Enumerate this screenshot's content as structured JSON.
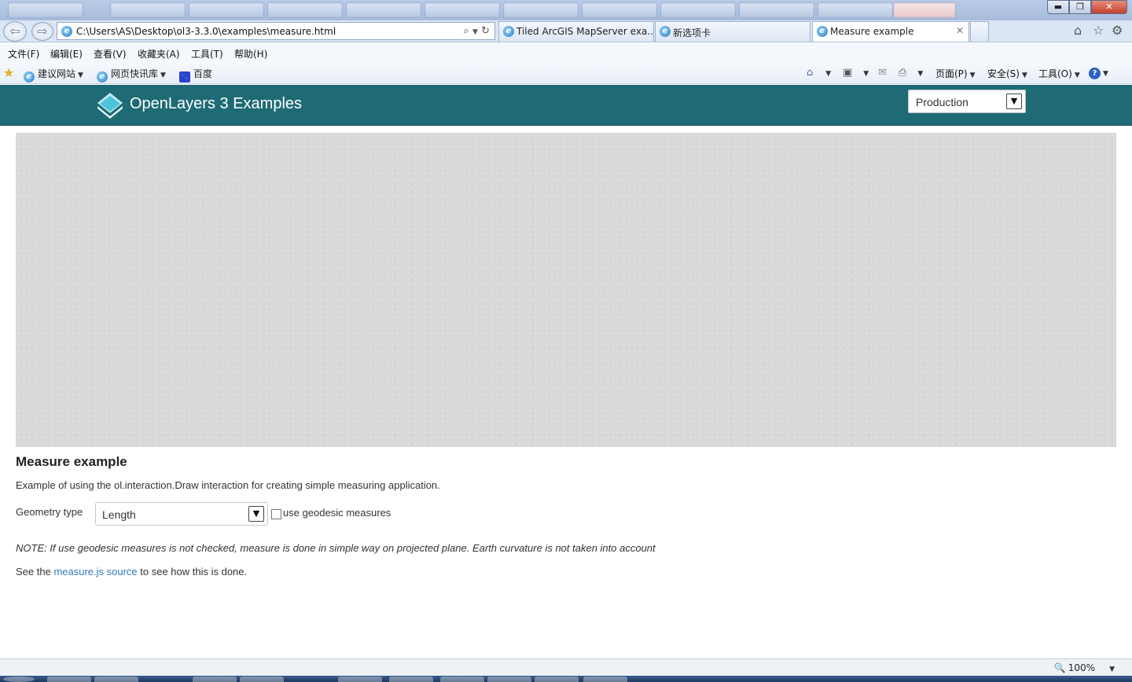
{
  "browser": {
    "address_url": "C:\\Users\\AS\\Desktop\\ol3-3.3.0\\examples\\measure.html",
    "tabs": [
      {
        "label": "Tiled ArcGIS MapServer exa...",
        "active": false
      },
      {
        "label": "新选项卡",
        "active": false
      },
      {
        "label": "Measure example",
        "active": true
      }
    ],
    "menu": [
      "文件(F)",
      "编辑(E)",
      "查看(V)",
      "收藏夹(A)",
      "工具(T)",
      "帮助(H)"
    ],
    "favorites": [
      "建议网站",
      "网页快讯库",
      "百度"
    ],
    "toolbar": {
      "page": "页面(P)",
      "safety": "安全(S)",
      "tools": "工具(O)"
    },
    "zoom_level": "100%"
  },
  "header": {
    "title": "OpenLayers 3 Examples",
    "version_selected": "Production",
    "bg_color": "#1f6b75"
  },
  "example": {
    "title": "Measure example",
    "description": "Example of using the ol.interaction.Draw interaction for creating simple measuring application.",
    "geometry_label": "Geometry type",
    "geometry_selected": "Length",
    "geodesic_label": "use geodesic measures",
    "geodesic_checked": false,
    "note": "NOTE: If use geodesic measures is not checked, measure is done in simple way on projected plane. Earth curvature is not taken into account",
    "see_prefix": "See the ",
    "see_link": "measure.js source",
    "see_suffix": " to see how this is done.",
    "link_color": "#2f7bb8"
  },
  "icons": {
    "back": "back-arrow-icon",
    "forward": "forward-arrow-icon",
    "search": "search-icon",
    "refresh": "refresh-icon",
    "home": "home-icon",
    "favorites": "star-icon",
    "settings": "gear-icon",
    "rss": "rss-icon",
    "mail": "mail-icon",
    "print": "printer-icon",
    "help": "help-icon"
  }
}
